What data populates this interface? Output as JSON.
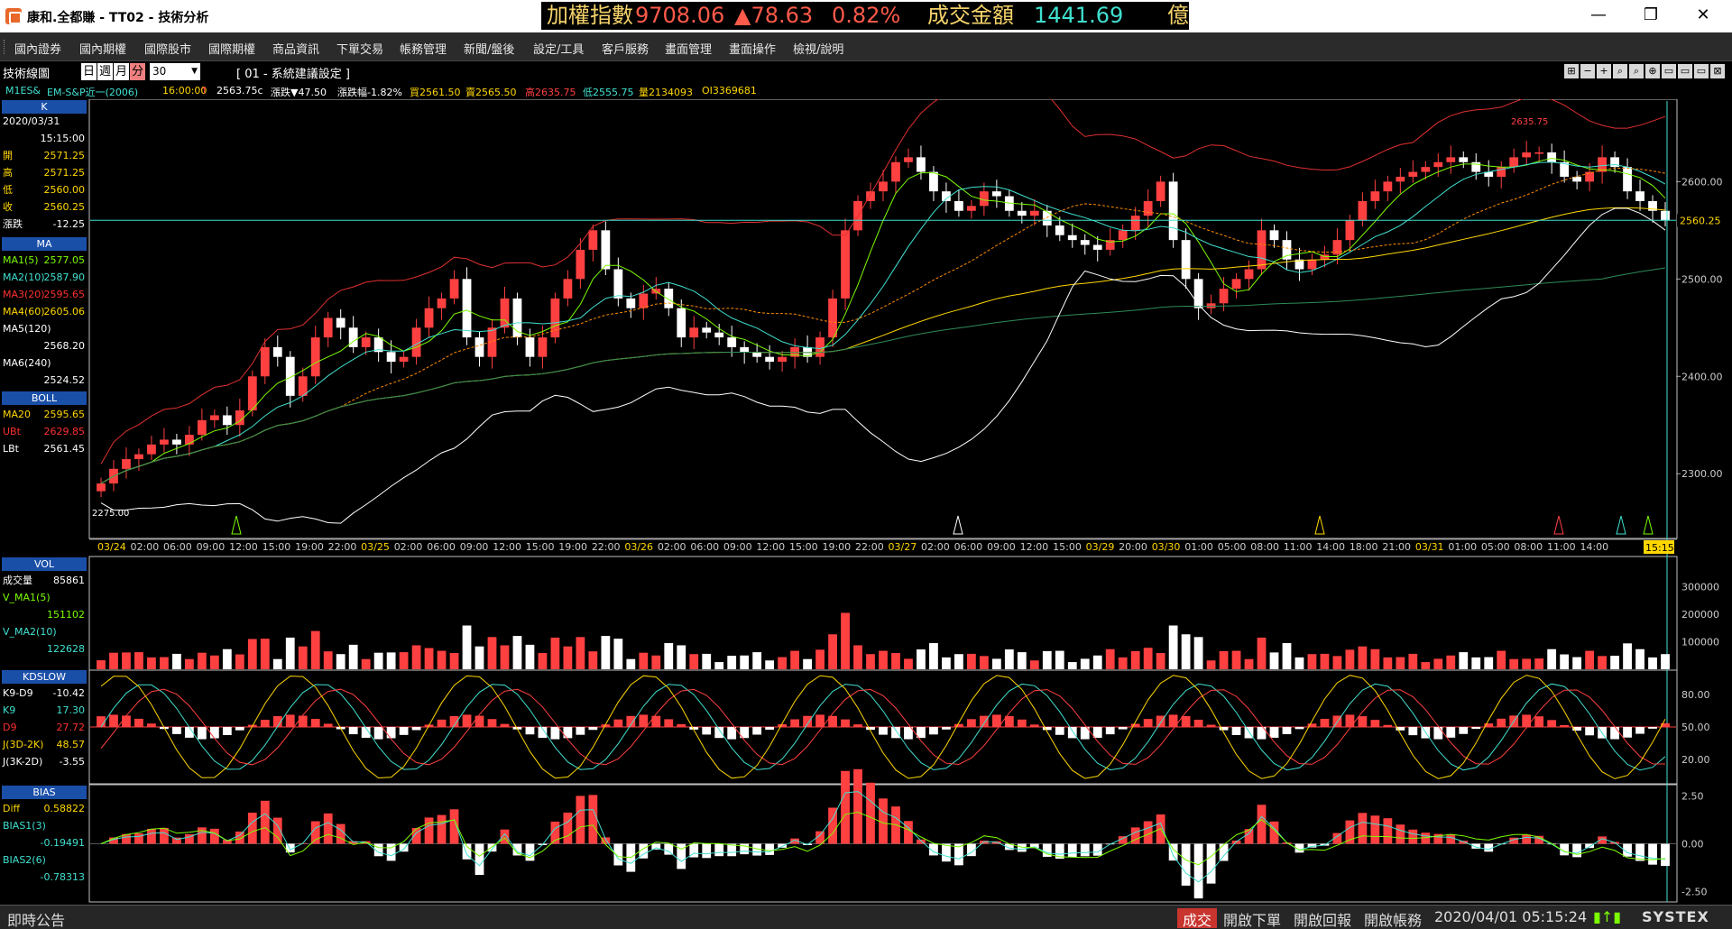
{
  "titlebar": {
    "title": "康和.全都賺 - TT02 - 技術分析",
    "ticker": {
      "index_label": "加權指數",
      "index_value": "9708.06",
      "index_change": "▲78.63",
      "index_pct": "0.82%",
      "amount_label": "成交金額",
      "amount_value": "1441.69",
      "amount_unit": "億"
    },
    "min": "—",
    "max": "❐",
    "close": "✕"
  },
  "menu": [
    "國內證券",
    "國內期權",
    "國際股市",
    "國際期權",
    "商品資訊",
    "下單交易",
    "帳務管理",
    "新聞/盤後",
    "設定/工具",
    "客戶服務",
    "畫面管理",
    "畫面操作",
    "檢視/說明"
  ],
  "toolbar": {
    "label": "技術線圖",
    "periods": [
      "日",
      "週",
      "月",
      "分"
    ],
    "active_period": "分",
    "interval": "30",
    "setting": "[ 01 - 系統建議設定 ]",
    "icons": [
      "⊞",
      "−",
      "+",
      "⌕",
      "⌕",
      "⊕",
      "▭",
      "▭",
      "▭",
      "⊠"
    ]
  },
  "inforow": {
    "symbol": "M1ES&",
    "name": "EM-S&P近一(2006)",
    "time": "16:00:00",
    "arrow": "↑",
    "last": "2563.75c",
    "change": "漲跌▼47.50",
    "change_pct": "漲跌幅-1.82%",
    "bid": "買2561.50",
    "ask": "賣2565.50",
    "high": "高2635.75",
    "low": "低2555.75",
    "volume": "量2134093",
    "oi": "OI3369681"
  },
  "left_panel": {
    "k": {
      "header": "K",
      "date": "2020/03/31",
      "time": "15:15:00",
      "rows": [
        {
          "label": "開",
          "value": "2571.25"
        },
        {
          "label": "高",
          "value": "2571.25"
        },
        {
          "label": "低",
          "value": "2560.00"
        },
        {
          "label": "收",
          "value": "2560.25"
        },
        {
          "label": "漲跌",
          "value": "-12.25"
        }
      ]
    },
    "ma": {
      "header": "MA",
      "rows": [
        {
          "label": "MA1(5)",
          "value": "2577.05",
          "color": "#7cfc00"
        },
        {
          "label": "MA2(10)",
          "value": "2587.90",
          "color": "#40e0d0"
        },
        {
          "label": "MA3(20)",
          "value": "2595.65",
          "color": "#ff3030"
        },
        {
          "label": "MA4(60)",
          "value": "2605.06",
          "color": "#ffd700"
        },
        {
          "label": "MA5(120)",
          "value": "2568.20",
          "color": "#ffffff"
        },
        {
          "label": "MA6(240)",
          "value": "2524.52",
          "color": "#ffffff"
        }
      ]
    },
    "boll": {
      "header": "BOLL",
      "rows": [
        {
          "label": "MA20",
          "value": "2595.65",
          "color": "#ffd700"
        },
        {
          "label": "UBt",
          "value": "2629.85",
          "color": "#ff3030"
        },
        {
          "label": "LBt",
          "value": "2561.45",
          "color": "#ffffff"
        }
      ]
    },
    "vol": {
      "header": "VOL",
      "rows": [
        {
          "label": "成交量",
          "value": "85861",
          "color": "#ffffff"
        },
        {
          "label": "V_MA1(5)",
          "value": "151102",
          "color": "#7cfc00"
        },
        {
          "label": "V_MA2(10)",
          "value": "122628",
          "color": "#40e0d0"
        }
      ]
    },
    "kd": {
      "header": "KDSLOW",
      "rows": [
        {
          "label": "K9-D9",
          "value": "-10.42",
          "color": "#ffffff"
        },
        {
          "label": "K9",
          "value": "17.30",
          "color": "#40e0d0"
        },
        {
          "label": "D9",
          "value": "27.72",
          "color": "#ff3030"
        },
        {
          "label": "J(3D-2K)",
          "value": "48.57",
          "color": "#ffd700"
        },
        {
          "label": "J(3K-2D)",
          "value": "-3.55",
          "color": "#ffffff"
        }
      ]
    },
    "bias": {
      "header": "BIAS",
      "rows": [
        {
          "label": "Diff",
          "value": "0.58822",
          "color": "#ffd700"
        },
        {
          "label": "BIAS1(3)",
          "value": "-0.19491",
          "color": "#40e0d0"
        },
        {
          "label": "BIAS2(6)",
          "value": "-0.78313",
          "color": "#40e0d0"
        }
      ]
    }
  },
  "chart_data": {
    "type": "candlestick",
    "y_ticks": [
      "2600.00",
      "2500.00",
      "2400.00",
      "2300.00"
    ],
    "ylim": [
      2240,
      2680
    ],
    "last_price_label": "2560.25",
    "high_label": "2635.75",
    "low_label": "2275.00",
    "x_labels": [
      {
        "text": "03/24",
        "date": true
      },
      {
        "text": "02:00"
      },
      {
        "text": "06:00"
      },
      {
        "text": "09:00"
      },
      {
        "text": "12:00"
      },
      {
        "text": "15:00"
      },
      {
        "text": "19:00"
      },
      {
        "text": "22:00"
      },
      {
        "text": "03/25",
        "date": true
      },
      {
        "text": "02:00"
      },
      {
        "text": "06:00"
      },
      {
        "text": "09:00"
      },
      {
        "text": "12:00"
      },
      {
        "text": "15:00"
      },
      {
        "text": "19:00"
      },
      {
        "text": "22:00"
      },
      {
        "text": "03/26",
        "date": true
      },
      {
        "text": "02:00"
      },
      {
        "text": "06:00"
      },
      {
        "text": "09:00"
      },
      {
        "text": "12:00"
      },
      {
        "text": "15:00"
      },
      {
        "text": "19:00"
      },
      {
        "text": "22:00"
      },
      {
        "text": "03/27",
        "date": true
      },
      {
        "text": "02:00"
      },
      {
        "text": "06:00"
      },
      {
        "text": "09:00"
      },
      {
        "text": "12:00"
      },
      {
        "text": "15:00"
      },
      {
        "text": "03/29",
        "date": true
      },
      {
        "text": "20:00"
      },
      {
        "text": "03/30",
        "date": true
      },
      {
        "text": "01:00"
      },
      {
        "text": "05:00"
      },
      {
        "text": "08:00"
      },
      {
        "text": "11:00"
      },
      {
        "text": "14:00"
      },
      {
        "text": "18:00"
      },
      {
        "text": "21:00"
      },
      {
        "text": "03/31",
        "date": true
      },
      {
        "text": "01:00"
      },
      {
        "text": "05:00"
      },
      {
        "text": "08:00"
      },
      {
        "text": "11:00"
      },
      {
        "text": "14:00"
      }
    ],
    "cursor_time": "15:15",
    "closes": [
      2290,
      2305,
      2315,
      2320,
      2330,
      2335,
      2330,
      2340,
      2355,
      2360,
      2350,
      2365,
      2400,
      2430,
      2420,
      2380,
      2400,
      2440,
      2460,
      2450,
      2430,
      2440,
      2425,
      2415,
      2420,
      2450,
      2470,
      2480,
      2500,
      2440,
      2420,
      2450,
      2480,
      2440,
      2420,
      2440,
      2480,
      2500,
      2530,
      2550,
      2510,
      2480,
      2470,
      2485,
      2490,
      2470,
      2440,
      2450,
      2445,
      2440,
      2430,
      2425,
      2420,
      2415,
      2420,
      2430,
      2420,
      2440,
      2480,
      2550,
      2580,
      2590,
      2600,
      2620,
      2625,
      2610,
      2590,
      2580,
      2570,
      2575,
      2590,
      2585,
      2570,
      2565,
      2570,
      2555,
      2545,
      2540,
      2535,
      2530,
      2540,
      2550,
      2565,
      2580,
      2600,
      2540,
      2500,
      2470,
      2475,
      2490,
      2500,
      2510,
      2550,
      2540,
      2520,
      2510,
      2520,
      2525,
      2540,
      2560,
      2580,
      2590,
      2600,
      2605,
      2610,
      2615,
      2620,
      2625,
      2620,
      2610,
      2605,
      2615,
      2625,
      2630,
      2630,
      2620,
      2605,
      2600,
      2610,
      2625,
      2615,
      2590,
      2580,
      2570,
      2560
    ],
    "volume_ylim": [
      0,
      400000
    ],
    "volume_ticks": [
      "300000",
      "200000",
      "100000"
    ],
    "kd_ticks": [
      "80.00",
      "50.00",
      "20.00"
    ],
    "bias_ticks": [
      "2.50",
      "0.00",
      "-2.50"
    ]
  },
  "statusbar": {
    "notice": "即時公告",
    "trade": "成交",
    "order": "開啟下單",
    "report": "開啟回報",
    "account": "開啟帳務",
    "datetime": "2020/04/01 05:15:24",
    "brand": "SYSTEX"
  },
  "colors": {
    "up": "#ff4040",
    "down": "#ffffff",
    "grid": "#1c1c1c",
    "header": "#1a4fa8",
    "cyan": "#40e0d0"
  }
}
